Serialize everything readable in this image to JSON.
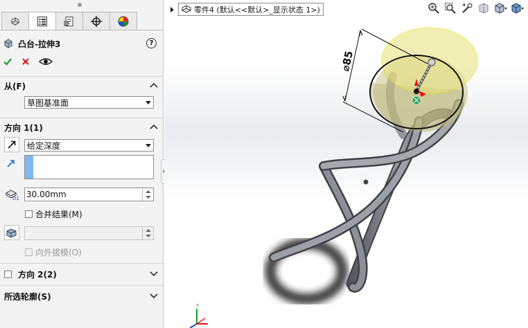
{
  "tabs": [
    {
      "name": "feature-manager",
      "icon": "feature-tree-icon",
      "active": false
    },
    {
      "name": "property-manager",
      "icon": "property-list-icon",
      "active": true
    },
    {
      "name": "configuration-manager",
      "icon": "configuration-icon",
      "active": false
    },
    {
      "name": "dimxpert-manager",
      "icon": "crosshair-icon",
      "active": false
    },
    {
      "name": "display-manager",
      "icon": "color-wheel-icon",
      "active": false
    }
  ],
  "feature": {
    "title": "凸台-拉伸3",
    "help": "?"
  },
  "from": {
    "label": "从(F)",
    "value": "草图基准面"
  },
  "direction1": {
    "label": "方向 1(1)",
    "end_condition": "给定深度",
    "depth": "30.00mm",
    "merge_label": "合并结果(M)",
    "draft_label": "向外拔模(O)"
  },
  "direction2": {
    "label": "方向 2(2)"
  },
  "contours": {
    "label": "所选轮廓(S)"
  },
  "viewport": {
    "breadcrumb": "零件4  (默认<<默认>_显示状态 1>)",
    "dimension": "⌀85",
    "triad_y": "Y"
  },
  "colors": {
    "accent_blue": "#7fb7ef",
    "confirm_green": "#1e9e2a",
    "cancel_red": "#d11a1a",
    "preview_yellow": "#e8e27a",
    "tube_gray": "#6f7178"
  }
}
